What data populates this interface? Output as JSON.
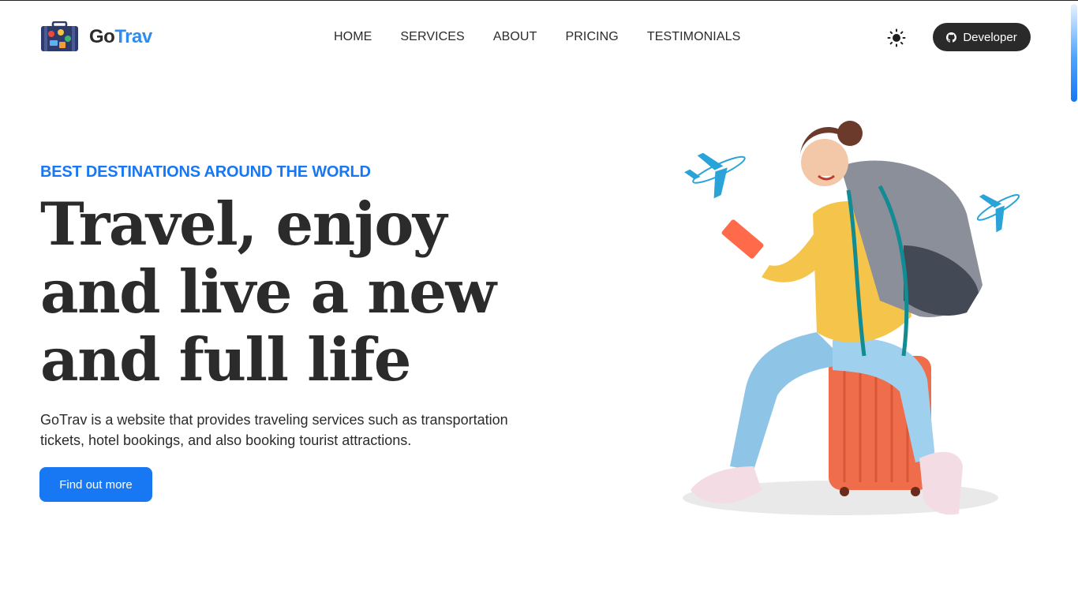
{
  "brand": {
    "name_part1": "Go",
    "name_part2": "Trav",
    "accent": "#2f8cf0"
  },
  "nav": {
    "items": [
      {
        "label": "HOME"
      },
      {
        "label": "SERVICES"
      },
      {
        "label": "ABOUT"
      },
      {
        "label": "PRICING"
      },
      {
        "label": "TESTIMONIALS"
      }
    ]
  },
  "header_actions": {
    "theme_icon": "sun-icon",
    "developer_label": "Developer",
    "developer_icon": "github-icon"
  },
  "hero": {
    "eyebrow": "BEST DESTINATIONS AROUND THE WORLD",
    "headline_lines": [
      "Travel, enjoy",
      "and live a new",
      "and full life"
    ],
    "description_line1": "GoTrav is a website that provides traveling services such as transportation",
    "description_line2": "tickets, hotel bookings, and also booking tourist attractions.",
    "cta_label": "Find out more"
  },
  "colors": {
    "primary": "#1877f2",
    "dark": "#2b2b2b",
    "button_dark": "#2a2a2a"
  }
}
